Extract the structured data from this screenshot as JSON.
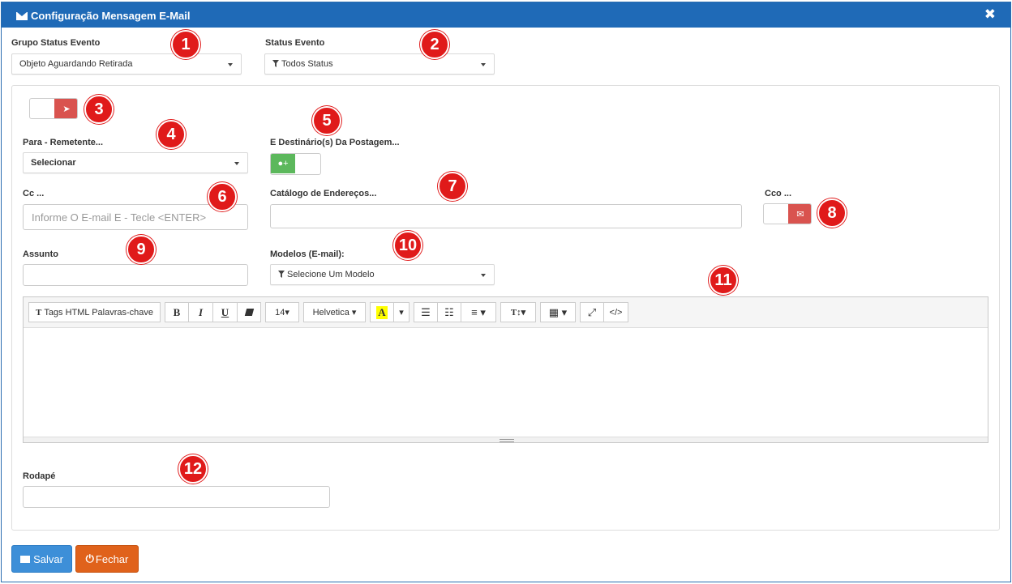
{
  "window": {
    "title": "Configuração Mensagem E-Mail",
    "close_glyph": "✖"
  },
  "grupo_status": {
    "label": "Grupo Status Evento",
    "value": "Objeto Aguardando Retirada"
  },
  "status_evento": {
    "label": "Status Evento",
    "value": "Todos Status"
  },
  "para": {
    "label": "Para - Remetente...",
    "value": "Selecionar"
  },
  "destinatarios": {
    "label": "E Destinário(s) Da Postagem..."
  },
  "cc": {
    "label": "Cc ...",
    "placeholder": "Informe O E-mail E - Tecle <ENTER>"
  },
  "catalogo": {
    "label": "Catálogo de Endereços..."
  },
  "cco": {
    "label": "Cco ..."
  },
  "assunto": {
    "label": "Assunto"
  },
  "modelos": {
    "label": "Modelos (E-mail):",
    "value": "Selecione Um Modelo"
  },
  "editor": {
    "toolbar": {
      "tags": "Tags HTML Palavras-chave",
      "bold": "B",
      "italic": "I",
      "underline": "U",
      "font_size": "14▾",
      "font_family": "Helvetica ▾",
      "color_letter": "A",
      "color_dropdown": "▾",
      "ul": "☰",
      "ol": "☷",
      "align": "≡ ▾",
      "line_height": "T↕▾",
      "table": "▦ ▾",
      "fullscreen": "⤢",
      "code": "</>"
    }
  },
  "rodape": {
    "label": "Rodapé"
  },
  "buttons": {
    "save": "Salvar",
    "close": "Fechar"
  },
  "badges": [
    "1",
    "2",
    "3",
    "4",
    "5",
    "6",
    "7",
    "8",
    "9",
    "10",
    "11",
    "12"
  ],
  "colors": {
    "header": "#1f6ab7",
    "badge": "#e01a1a",
    "toggle_red": "#d9534f",
    "toggle_green": "#5cb85c",
    "save": "#3d8fd8",
    "close": "#e0621b"
  }
}
